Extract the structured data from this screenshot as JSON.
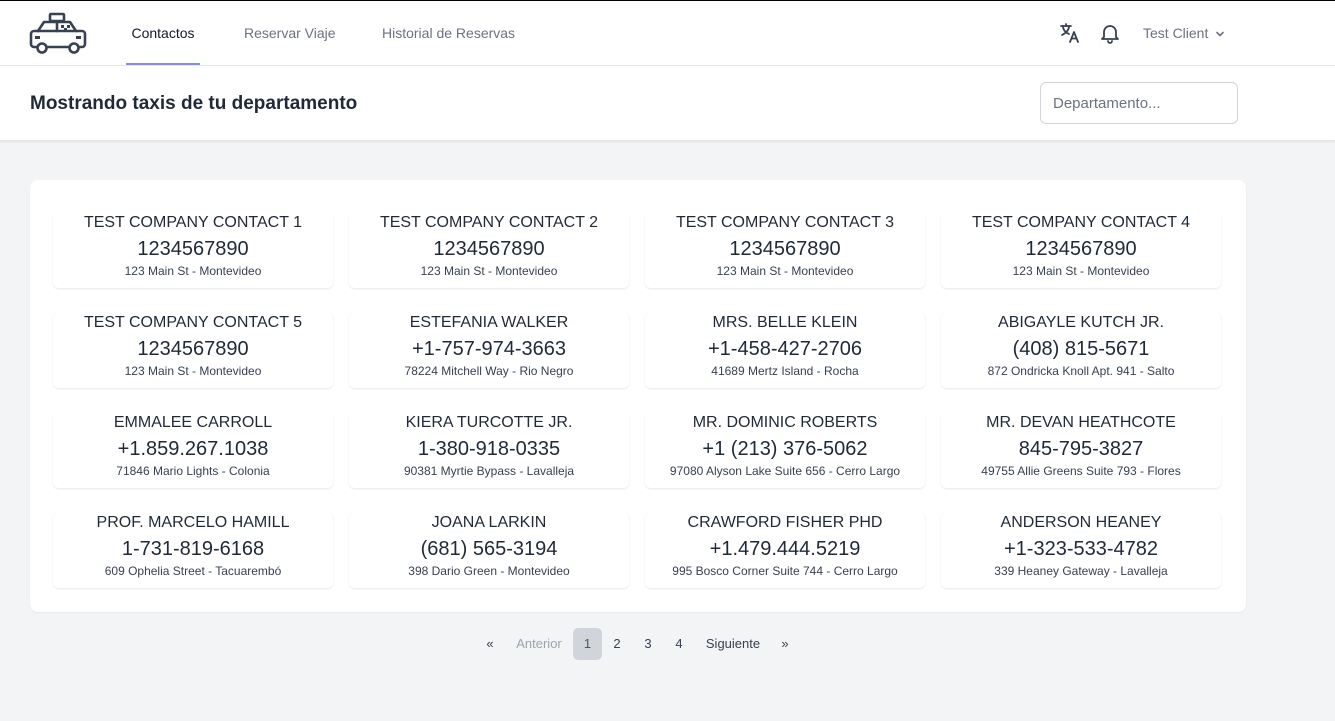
{
  "nav": {
    "logo": "taxi-logo",
    "links": [
      {
        "label": "Contactos",
        "active": true
      },
      {
        "label": "Reservar Viaje",
        "active": false
      },
      {
        "label": "Historial de Reservas",
        "active": false
      }
    ],
    "translate_icon": "translate-icon",
    "bell_icon": "bell-icon",
    "user_name": "Test Client",
    "user_chevron": "chevron-down-icon"
  },
  "subheader": {
    "title": "Mostrando taxis de tu departamento",
    "department_placeholder": "Departamento...",
    "department_value": ""
  },
  "contacts": [
    {
      "name": "Test Company Contact 1",
      "phone": "1234567890",
      "address": "123 Main St - Montevideo"
    },
    {
      "name": "Test Company Contact 2",
      "phone": "1234567890",
      "address": "123 Main St - Montevideo"
    },
    {
      "name": "Test Company Contact 3",
      "phone": "1234567890",
      "address": "123 Main St - Montevideo"
    },
    {
      "name": "Test Company Contact 4",
      "phone": "1234567890",
      "address": "123 Main St - Montevideo"
    },
    {
      "name": "Test Company Contact 5",
      "phone": "1234567890",
      "address": "123 Main St - Montevideo"
    },
    {
      "name": "Estefania Walker",
      "phone": "+1-757-974-3663",
      "address": "78224 Mitchell Way - Rio Negro"
    },
    {
      "name": "Mrs. Belle Klein",
      "phone": "+1-458-427-2706",
      "address": "41689 Mertz Island - Rocha"
    },
    {
      "name": "Abigayle Kutch Jr.",
      "phone": "(408) 815-5671",
      "address": "872 Ondricka Knoll Apt. 941 - Salto"
    },
    {
      "name": "Emmalee Carroll",
      "phone": "+1.859.267.1038",
      "address": "71846 Mario Lights - Colonia"
    },
    {
      "name": "Kiera Turcotte Jr.",
      "phone": "1-380-918-0335",
      "address": "90381 Myrtie Bypass - Lavalleja"
    },
    {
      "name": "Mr. Dominic Roberts",
      "phone": "+1 (213) 376-5062",
      "address": "97080 Alyson Lake Suite 656 - Cerro Largo"
    },
    {
      "name": "Mr. Devan Heathcote",
      "phone": "845-795-3827",
      "address": "49755 Allie Greens Suite 793 - Flores"
    },
    {
      "name": "Prof. Marcelo Hamill",
      "phone": "1-731-819-6168",
      "address": "609 Ophelia Street - Tacuarembó"
    },
    {
      "name": "Joana Larkin",
      "phone": "(681) 565-3194",
      "address": "398 Dario Green - Montevideo"
    },
    {
      "name": "Crawford Fisher PhD",
      "phone": "+1.479.444.5219",
      "address": "995 Bosco Corner Suite 744 - Cerro Largo"
    },
    {
      "name": "Anderson Heaney",
      "phone": "+1-323-533-4782",
      "address": "339 Heaney Gateway - Lavalleja"
    }
  ],
  "pagination": {
    "first": "«",
    "prev": "Anterior",
    "pages": [
      "1",
      "2",
      "3",
      "4"
    ],
    "current": "1",
    "next": "Siguiente",
    "last": "»"
  },
  "colors": {
    "active_tab_underline": "#818cf8",
    "current_page_bg": "#d1d5db",
    "page_bg": "#f3f4f6"
  }
}
